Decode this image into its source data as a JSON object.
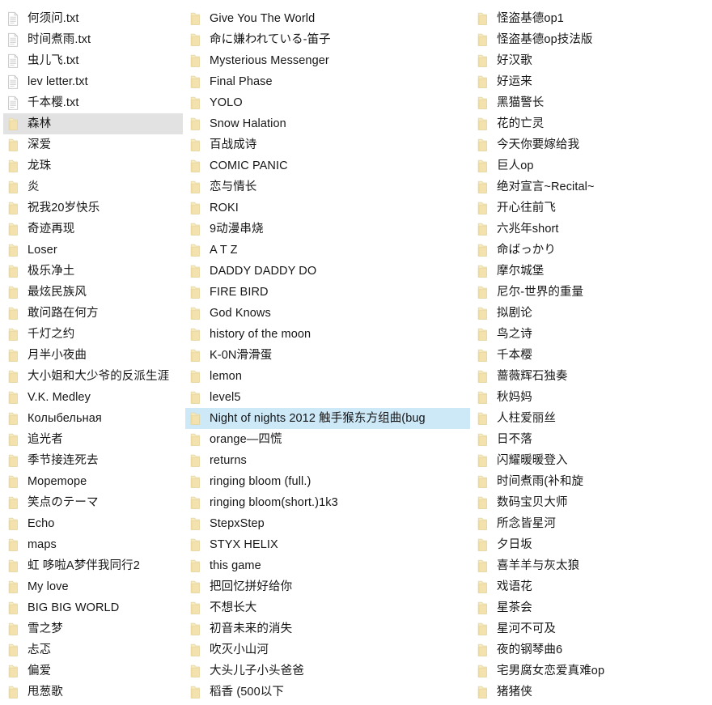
{
  "view": {
    "app": "file-explorer",
    "layout": "list",
    "columns": 3,
    "background_color": "#ffffff",
    "selection_color": "#cde8f7",
    "hover_color": "#e2e2e2",
    "folder_icon_color": "#f3e3b0",
    "text_file_icon_color": "#d8d8d8"
  },
  "columns": [
    {
      "index": 0,
      "items": [
        {
          "name": "何须问.txt",
          "icon": "text-file-icon",
          "type": "file",
          "state": "normal"
        },
        {
          "name": "时间煮雨.txt",
          "icon": "text-file-icon",
          "type": "file",
          "state": "normal"
        },
        {
          "name": "虫儿飞.txt",
          "icon": "text-file-icon",
          "type": "file",
          "state": "normal"
        },
        {
          "name": "lev letter.txt",
          "icon": "text-file-icon",
          "type": "file",
          "state": "normal"
        },
        {
          "name": "千本樱.txt",
          "icon": "text-file-icon",
          "type": "file",
          "state": "normal"
        },
        {
          "name": "森林",
          "icon": "folder-icon",
          "type": "folder",
          "state": "hovered"
        },
        {
          "name": "深爱",
          "icon": "folder-icon",
          "type": "folder",
          "state": "normal"
        },
        {
          "name": "龙珠",
          "icon": "folder-icon",
          "type": "folder",
          "state": "normal"
        },
        {
          "name": "炎",
          "icon": "folder-icon",
          "type": "folder",
          "state": "normal"
        },
        {
          "name": "祝我20岁快乐",
          "icon": "folder-icon",
          "type": "folder",
          "state": "normal"
        },
        {
          "name": "奇迹再现",
          "icon": "folder-icon",
          "type": "folder",
          "state": "normal"
        },
        {
          "name": "Loser",
          "icon": "folder-icon",
          "type": "folder",
          "state": "normal"
        },
        {
          "name": "极乐净土",
          "icon": "folder-icon",
          "type": "folder",
          "state": "normal"
        },
        {
          "name": "最炫民族风",
          "icon": "folder-icon",
          "type": "folder",
          "state": "normal"
        },
        {
          "name": "敢问路在何方",
          "icon": "folder-icon",
          "type": "folder",
          "state": "normal"
        },
        {
          "name": "千灯之约",
          "icon": "folder-icon",
          "type": "folder",
          "state": "normal"
        },
        {
          "name": "月半小夜曲",
          "icon": "folder-icon",
          "type": "folder",
          "state": "normal"
        },
        {
          "name": "大小姐和大少爷的反派生涯",
          "icon": "folder-icon",
          "type": "folder",
          "state": "normal"
        },
        {
          "name": "V.K. Medley",
          "icon": "folder-icon",
          "type": "folder",
          "state": "normal"
        },
        {
          "name": "Колыбельная",
          "icon": "folder-icon",
          "type": "folder",
          "state": "normal"
        },
        {
          "name": "追光者",
          "icon": "folder-icon",
          "type": "folder",
          "state": "normal"
        },
        {
          "name": "季节接连死去",
          "icon": "folder-icon",
          "type": "folder",
          "state": "normal"
        },
        {
          "name": "Mopemope",
          "icon": "folder-icon",
          "type": "folder",
          "state": "normal"
        },
        {
          "name": "笑点のテーマ",
          "icon": "folder-icon",
          "type": "folder",
          "state": "normal"
        },
        {
          "name": "Echo",
          "icon": "folder-icon",
          "type": "folder",
          "state": "normal"
        },
        {
          "name": "maps",
          "icon": "folder-icon",
          "type": "folder",
          "state": "normal"
        },
        {
          "name": "虹 哆啦A梦伴我同行2",
          "icon": "folder-icon",
          "type": "folder",
          "state": "normal"
        },
        {
          "name": "My love",
          "icon": "folder-icon",
          "type": "folder",
          "state": "normal"
        },
        {
          "name": "BIG BIG WORLD",
          "icon": "folder-icon",
          "type": "folder",
          "state": "normal"
        },
        {
          "name": "雪之梦",
          "icon": "folder-icon",
          "type": "folder",
          "state": "normal"
        },
        {
          "name": "忐忑",
          "icon": "folder-icon",
          "type": "folder",
          "state": "normal"
        },
        {
          "name": "偏爱",
          "icon": "folder-icon",
          "type": "folder",
          "state": "normal"
        },
        {
          "name": "甩葱歌",
          "icon": "folder-icon",
          "type": "folder",
          "state": "normal"
        }
      ]
    },
    {
      "index": 1,
      "items": [
        {
          "name": "Give You The World",
          "icon": "folder-icon",
          "type": "folder",
          "state": "normal"
        },
        {
          "name": "命に嫌われている-笛子",
          "icon": "folder-icon",
          "type": "folder",
          "state": "normal"
        },
        {
          "name": "Mysterious Messenger",
          "icon": "folder-icon",
          "type": "folder",
          "state": "normal"
        },
        {
          "name": "Final Phase",
          "icon": "folder-icon",
          "type": "folder",
          "state": "normal"
        },
        {
          "name": "YOLO",
          "icon": "folder-icon",
          "type": "folder",
          "state": "normal"
        },
        {
          "name": "Snow Halation",
          "icon": "folder-icon",
          "type": "folder",
          "state": "normal"
        },
        {
          "name": "百战成诗",
          "icon": "folder-icon",
          "type": "folder",
          "state": "normal"
        },
        {
          "name": "COMIC PANIC",
          "icon": "folder-icon",
          "type": "folder",
          "state": "normal"
        },
        {
          "name": "恋与情长",
          "icon": "folder-icon",
          "type": "folder",
          "state": "normal"
        },
        {
          "name": "ROKI",
          "icon": "folder-icon",
          "type": "folder",
          "state": "normal"
        },
        {
          "name": "9动漫串烧",
          "icon": "folder-icon",
          "type": "folder",
          "state": "normal"
        },
        {
          "name": "A T Z",
          "icon": "folder-icon",
          "type": "folder",
          "state": "normal"
        },
        {
          "name": "DADDY DADDY DO",
          "icon": "folder-icon",
          "type": "folder",
          "state": "normal"
        },
        {
          "name": "FIRE BIRD",
          "icon": "folder-icon",
          "type": "folder",
          "state": "normal"
        },
        {
          "name": "God Knows",
          "icon": "folder-icon",
          "type": "folder",
          "state": "normal"
        },
        {
          "name": "history of the moon",
          "icon": "folder-icon",
          "type": "folder",
          "state": "normal"
        },
        {
          "name": "K-0N滑滑蛋",
          "icon": "folder-icon",
          "type": "folder",
          "state": "normal"
        },
        {
          "name": "lemon",
          "icon": "folder-icon",
          "type": "folder",
          "state": "normal"
        },
        {
          "name": "level5",
          "icon": "folder-icon",
          "type": "folder",
          "state": "normal"
        },
        {
          "name": "Night of nights 2012 触手猴东方组曲(bug",
          "icon": "folder-icon",
          "type": "folder",
          "state": "selected"
        },
        {
          "name": "orange—四慌",
          "icon": "folder-icon",
          "type": "folder",
          "state": "normal"
        },
        {
          "name": "returns",
          "icon": "folder-icon",
          "type": "folder",
          "state": "normal"
        },
        {
          "name": "ringing bloom  (full.)",
          "icon": "folder-icon",
          "type": "folder",
          "state": "normal"
        },
        {
          "name": "ringing bloom(short.)1k3",
          "icon": "folder-icon",
          "type": "folder",
          "state": "normal"
        },
        {
          "name": "StepxStep",
          "icon": "folder-icon",
          "type": "folder",
          "state": "normal"
        },
        {
          "name": "STYX HELIX",
          "icon": "folder-icon",
          "type": "folder",
          "state": "normal"
        },
        {
          "name": "this game",
          "icon": "folder-icon",
          "type": "folder",
          "state": "normal"
        },
        {
          "name": "把回忆拼好给你",
          "icon": "folder-icon",
          "type": "folder",
          "state": "normal"
        },
        {
          "name": "不想长大",
          "icon": "folder-icon",
          "type": "folder",
          "state": "normal"
        },
        {
          "name": "初音未来的消失",
          "icon": "folder-icon",
          "type": "folder",
          "state": "normal"
        },
        {
          "name": "吹灭小山河",
          "icon": "folder-icon",
          "type": "folder",
          "state": "normal"
        },
        {
          "name": "大头儿子小头爸爸",
          "icon": "folder-icon",
          "type": "folder",
          "state": "normal"
        },
        {
          "name": "稻香 (500以下",
          "icon": "folder-icon",
          "type": "folder",
          "state": "normal"
        }
      ]
    },
    {
      "index": 2,
      "items": [
        {
          "name": "怪盗基德op1",
          "icon": "folder-icon",
          "type": "folder",
          "state": "normal"
        },
        {
          "name": "怪盗基德op技法版",
          "icon": "folder-icon",
          "type": "folder",
          "state": "normal"
        },
        {
          "name": "好汉歌",
          "icon": "folder-icon",
          "type": "folder",
          "state": "normal"
        },
        {
          "name": "好运来",
          "icon": "folder-icon",
          "type": "folder",
          "state": "normal"
        },
        {
          "name": "黑猫警长",
          "icon": "folder-icon",
          "type": "folder",
          "state": "normal"
        },
        {
          "name": "花的亡灵",
          "icon": "folder-icon",
          "type": "folder",
          "state": "normal"
        },
        {
          "name": "今天你要嫁给我",
          "icon": "folder-icon",
          "type": "folder",
          "state": "normal"
        },
        {
          "name": "巨人op",
          "icon": "folder-icon",
          "type": "folder",
          "state": "normal"
        },
        {
          "name": "绝对宣言~Recital~",
          "icon": "folder-icon",
          "type": "folder",
          "state": "normal"
        },
        {
          "name": "开心往前飞",
          "icon": "folder-icon",
          "type": "folder",
          "state": "normal"
        },
        {
          "name": "六兆年short",
          "icon": "folder-icon",
          "type": "folder",
          "state": "normal"
        },
        {
          "name": "命ばっかり",
          "icon": "folder-icon",
          "type": "folder",
          "state": "normal"
        },
        {
          "name": "摩尔城堡",
          "icon": "folder-icon",
          "type": "folder",
          "state": "normal"
        },
        {
          "name": "尼尔-世界的重量",
          "icon": "folder-icon",
          "type": "folder",
          "state": "normal"
        },
        {
          "name": "拟剧论",
          "icon": "folder-icon",
          "type": "folder",
          "state": "normal"
        },
        {
          "name": "鸟之诗",
          "icon": "folder-icon",
          "type": "folder",
          "state": "normal"
        },
        {
          "name": "千本樱",
          "icon": "folder-icon",
          "type": "folder",
          "state": "normal"
        },
        {
          "name": "蔷薇辉石独奏",
          "icon": "folder-icon",
          "type": "folder",
          "state": "normal"
        },
        {
          "name": "秋妈妈",
          "icon": "folder-icon",
          "type": "folder",
          "state": "normal"
        },
        {
          "name": "人柱爱丽丝",
          "icon": "folder-icon",
          "type": "folder",
          "state": "normal"
        },
        {
          "name": "日不落",
          "icon": "folder-icon",
          "type": "folder",
          "state": "normal"
        },
        {
          "name": "闪耀暖暖登入",
          "icon": "folder-icon",
          "type": "folder",
          "state": "normal"
        },
        {
          "name": "时间煮雨(补和旋",
          "icon": "folder-icon",
          "type": "folder",
          "state": "normal"
        },
        {
          "name": "数码宝贝大师",
          "icon": "folder-icon",
          "type": "folder",
          "state": "normal"
        },
        {
          "name": "所念皆星河",
          "icon": "folder-icon",
          "type": "folder",
          "state": "normal"
        },
        {
          "name": "夕日坂",
          "icon": "folder-icon",
          "type": "folder",
          "state": "normal"
        },
        {
          "name": "喜羊羊与灰太狼",
          "icon": "folder-icon",
          "type": "folder",
          "state": "normal"
        },
        {
          "name": "戏语花",
          "icon": "folder-icon",
          "type": "folder",
          "state": "normal"
        },
        {
          "name": "星茶会",
          "icon": "folder-icon",
          "type": "folder",
          "state": "normal"
        },
        {
          "name": "星河不可及",
          "icon": "folder-icon",
          "type": "folder",
          "state": "normal"
        },
        {
          "name": "夜的钢琴曲6",
          "icon": "folder-icon",
          "type": "folder",
          "state": "normal"
        },
        {
          "name": "宅男腐女恋爱真难op",
          "icon": "folder-icon",
          "type": "folder",
          "state": "normal"
        },
        {
          "name": "猪猪侠",
          "icon": "folder-icon",
          "type": "folder",
          "state": "normal"
        }
      ]
    }
  ]
}
